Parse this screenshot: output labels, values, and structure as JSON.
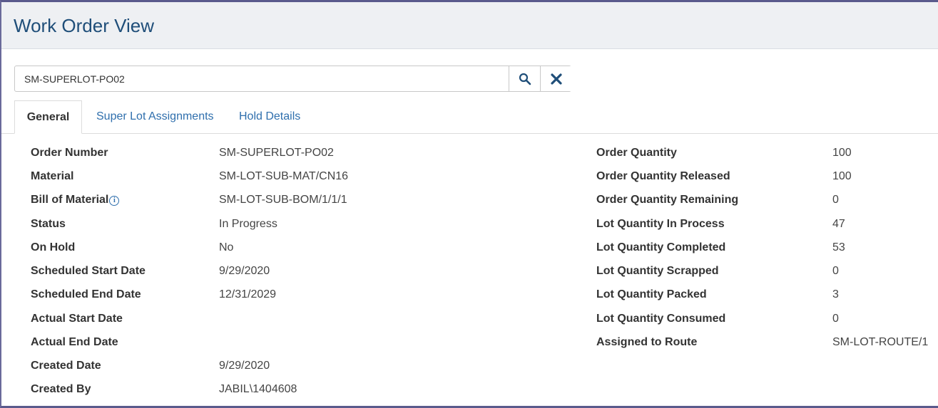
{
  "page": {
    "title": "Work Order View"
  },
  "search": {
    "value": "SM-SUPERLOT-PO02"
  },
  "tabs": [
    {
      "label": "General"
    },
    {
      "label": "Super Lot Assignments"
    },
    {
      "label": "Hold Details"
    }
  ],
  "general": {
    "left": [
      {
        "label": "Order Number",
        "value": "SM-SUPERLOT-PO02"
      },
      {
        "label": "Material",
        "value": "SM-LOT-SUB-MAT/CN16"
      },
      {
        "label": "Bill of Material",
        "value": "SM-LOT-SUB-BOM/1/1/1",
        "info_icon": "i"
      },
      {
        "label": "Status",
        "value": "In Progress"
      },
      {
        "label": "On Hold",
        "value": "No"
      },
      {
        "label": "Scheduled Start Date",
        "value": "9/29/2020"
      },
      {
        "label": "Scheduled End Date",
        "value": "12/31/2029"
      },
      {
        "label": "Actual Start Date",
        "value": ""
      },
      {
        "label": "Actual End Date",
        "value": ""
      },
      {
        "label": "Created Date",
        "value": "9/29/2020"
      },
      {
        "label": "Created By",
        "value": "JABIL\\1404608"
      }
    ],
    "right": [
      {
        "label": "Order Quantity",
        "value": "100"
      },
      {
        "label": "Order Quantity Released",
        "value": "100"
      },
      {
        "label": "Order Quantity Remaining",
        "value": "0"
      },
      {
        "label": "Lot Quantity In Process",
        "value": "47"
      },
      {
        "label": "Lot Quantity Completed",
        "value": "53"
      },
      {
        "label": "Lot Quantity Scrapped",
        "value": "0"
      },
      {
        "label": "Lot Quantity Packed",
        "value": "3"
      },
      {
        "label": "Lot Quantity Consumed",
        "value": "0"
      },
      {
        "label": "Assigned to Route",
        "value": "SM-LOT-ROUTE/1"
      }
    ]
  },
  "colors": {
    "accent": "#2f6fad",
    "title": "#1f4e79",
    "header_bg": "#eef0f3"
  }
}
